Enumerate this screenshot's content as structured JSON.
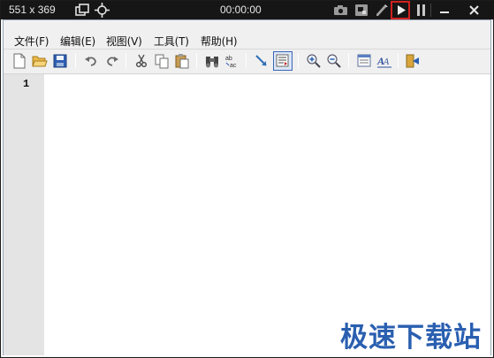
{
  "recorder": {
    "dimensions": "551 x 369",
    "timer": "00:00:00"
  },
  "menu": {
    "items": [
      {
        "label": "文件(F)"
      },
      {
        "label": "编辑(E)"
      },
      {
        "label": "视图(V)"
      },
      {
        "label": "工具(T)"
      },
      {
        "label": "帮助(H)"
      }
    ]
  },
  "editor": {
    "line_number": "1"
  },
  "watermark": {
    "text": "极速下载站"
  },
  "colors": {
    "recorder_bar": "#161616",
    "play_highlight": "#d0201f",
    "gutter": "#e4e4e4",
    "watermark": "#2a5fb0"
  }
}
